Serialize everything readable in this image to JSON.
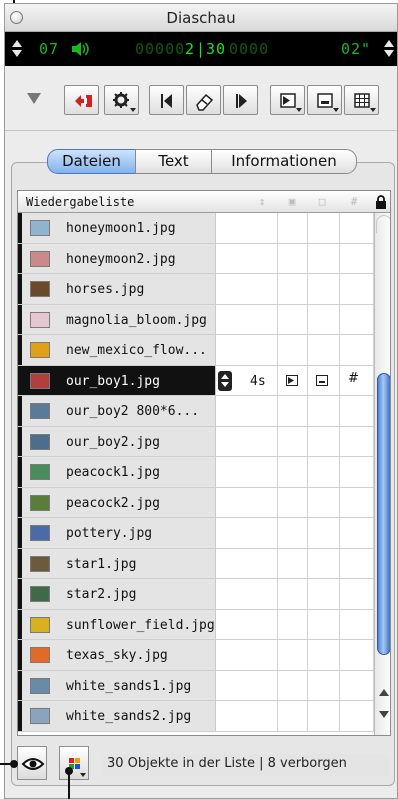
{
  "window": {
    "title": "Diaschau"
  },
  "timer": {
    "count_current": "07",
    "counter_dim_left": "00000",
    "counter_current": "2",
    "counter_sep": "|",
    "counter_total": "30",
    "counter_dim_right": "0000",
    "duration": "02\""
  },
  "tabs": [
    {
      "label": "Dateien",
      "selected": true
    },
    {
      "label": "Text",
      "selected": false
    },
    {
      "label": "Informationen",
      "selected": false
    }
  ],
  "list": {
    "header_label": "Wiedergabeliste",
    "rows": [
      {
        "name": "honeymoon1.jpg",
        "thumb_color": "#8fb4d0"
      },
      {
        "name": "honeymoon2.jpg",
        "thumb_color": "#c98a8a"
      },
      {
        "name": "horses.jpg",
        "thumb_color": "#6b4a2a"
      },
      {
        "name": "magnolia_bloom.jpg",
        "thumb_color": "#e6c7cf"
      },
      {
        "name": "new_mexico_flow...",
        "thumb_color": "#e0a11a"
      },
      {
        "name": "our_boy1.jpg",
        "thumb_color": "#b04040",
        "selected": true,
        "duration": "4s"
      },
      {
        "name": "our_boy2 800*6...",
        "thumb_color": "#5a7a9a"
      },
      {
        "name": "our_boy2.jpg",
        "thumb_color": "#4d6d8c"
      },
      {
        "name": "peacock1.jpg",
        "thumb_color": "#4a8c5a"
      },
      {
        "name": "peacock2.jpg",
        "thumb_color": "#5a7d3a"
      },
      {
        "name": "pottery.jpg",
        "thumb_color": "#4a6aa8"
      },
      {
        "name": "star1.jpg",
        "thumb_color": "#6d5a3a"
      },
      {
        "name": "star2.jpg",
        "thumb_color": "#3f6a4a"
      },
      {
        "name": "sunflower_field.jpg",
        "thumb_color": "#d8b020"
      },
      {
        "name": "texas_sky.jpg",
        "thumb_color": "#e06a2a"
      },
      {
        "name": "white_sands1.jpg",
        "thumb_color": "#6a8aa8"
      },
      {
        "name": "white_sands2.jpg",
        "thumb_color": "#8aa4c0"
      }
    ]
  },
  "status": {
    "text": "30 Objekte in der Liste | 8 verborgen"
  }
}
